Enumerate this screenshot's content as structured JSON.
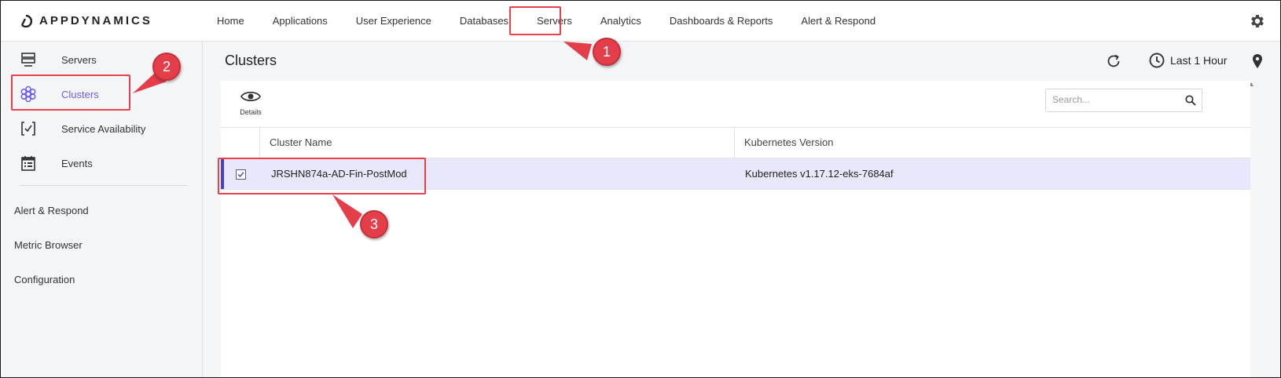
{
  "app": {
    "logo_text": "APPDYNAMICS"
  },
  "nav": {
    "items": [
      {
        "label": "Home"
      },
      {
        "label": "Applications"
      },
      {
        "label": "User Experience"
      },
      {
        "label": "Databases"
      },
      {
        "label": "Servers"
      },
      {
        "label": "Analytics"
      },
      {
        "label": "Dashboards & Reports"
      },
      {
        "label": "Alert & Respond"
      }
    ],
    "active": "Servers"
  },
  "sidebar": {
    "items": [
      {
        "label": "Servers",
        "icon": "server-icon"
      },
      {
        "label": "Clusters",
        "icon": "hexagon-cluster-icon",
        "active": true
      },
      {
        "label": "Service Availability",
        "icon": "check-box-icon"
      },
      {
        "label": "Events",
        "icon": "calendar-icon"
      }
    ],
    "links": [
      {
        "label": "Alert & Respond"
      },
      {
        "label": "Metric Browser"
      },
      {
        "label": "Configuration"
      }
    ]
  },
  "header": {
    "title": "Clusters",
    "time_range": "Last 1 Hour"
  },
  "toolbar": {
    "details_label": "Details"
  },
  "search": {
    "placeholder": "Search..."
  },
  "table": {
    "columns": [
      "Cluster Name",
      "Kubernetes Version"
    ],
    "rows": [
      {
        "cluster_name": "JRSHN874a-AD-Fin-PostMod",
        "kubernetes_version": "Kubernetes v1.17.12-eks-7684af",
        "selected": true
      }
    ]
  },
  "annotations": {
    "callouts": [
      "1",
      "2",
      "3"
    ],
    "color": "#e33e49"
  },
  "colors": {
    "accent": "#6b5cf0",
    "selected_row": "#e9e7fb",
    "row_marker": "#4a3fc6"
  }
}
